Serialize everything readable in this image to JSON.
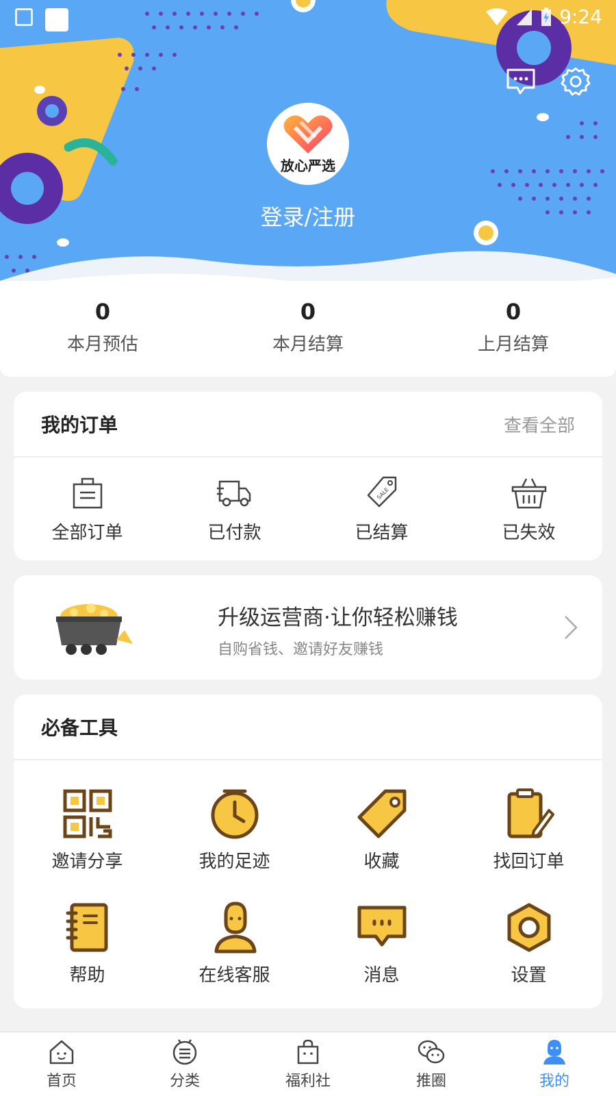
{
  "status_bar": {
    "time": "9:24"
  },
  "header": {
    "logo_text": "放心严选",
    "login_label": "登录/注册"
  },
  "earnings": [
    {
      "value": "0",
      "label": "本月预估"
    },
    {
      "value": "0",
      "label": "本月结算"
    },
    {
      "value": "0",
      "label": "上月结算"
    }
  ],
  "orders": {
    "title": "我的订单",
    "view_all": "查看全部",
    "items": [
      {
        "label": "全部订单",
        "icon": "bag-icon"
      },
      {
        "label": "已付款",
        "icon": "truck-icon"
      },
      {
        "label": "已结算",
        "icon": "sale-tag-icon"
      },
      {
        "label": "已失效",
        "icon": "basket-icon"
      }
    ]
  },
  "promo": {
    "title": "升级运营商·让你轻松赚钱",
    "subtitle": "自购省钱、邀请好友赚钱"
  },
  "tools": {
    "title": "必备工具",
    "items": [
      {
        "label": "邀请分享",
        "icon": "qr-code-icon"
      },
      {
        "label": "我的足迹",
        "icon": "clock-icon"
      },
      {
        "label": "收藏",
        "icon": "tag-icon"
      },
      {
        "label": "找回订单",
        "icon": "clipboard-icon"
      },
      {
        "label": "帮助",
        "icon": "notebook-icon"
      },
      {
        "label": "在线客服",
        "icon": "agent-icon"
      },
      {
        "label": "消息",
        "icon": "chat-icon"
      },
      {
        "label": "设置",
        "icon": "hex-gear-icon"
      }
    ]
  },
  "bottom_nav": {
    "items": [
      {
        "label": "首页",
        "icon": "home-icon"
      },
      {
        "label": "分类",
        "icon": "category-icon"
      },
      {
        "label": "福利社",
        "icon": "gift-bag-icon"
      },
      {
        "label": "推圈",
        "icon": "wechat-icon"
      },
      {
        "label": "我的",
        "icon": "profile-icon"
      }
    ],
    "active_index": 4
  },
  "colors": {
    "header_bg": "#5aa7f5",
    "accent_yellow": "#f7c744",
    "icon_brown": "#6b4417",
    "active_blue": "#3d8ff5"
  }
}
